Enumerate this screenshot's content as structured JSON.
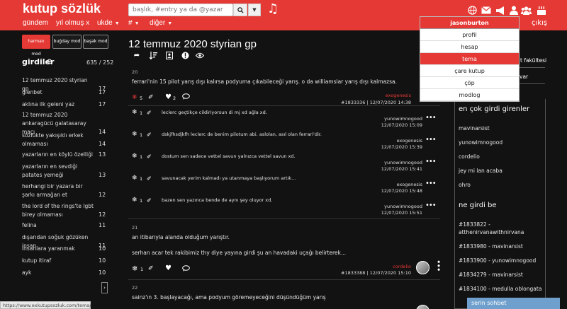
{
  "header": {
    "logo": "kutup sözlük",
    "search_placeholder": "başlık, #entry ya da @yazar",
    "nav": [
      "gündem",
      "yıl olmuş x",
      "ukde",
      "#",
      "diğer"
    ],
    "logout": "çıkış"
  },
  "user_menu": {
    "username": "jasonburton",
    "items": [
      "profil",
      "hesap",
      "tema",
      "çare kutup",
      "çöp",
      "modlog"
    ]
  },
  "sidebar": {
    "mods": [
      "harman mod",
      "buğday mod",
      "başak mod"
    ],
    "heading": "girdiler",
    "count": "635 / 252",
    "topics": [
      {
        "title": "12 temmuz 2020 styrian gp",
        "count": "17"
      },
      {
        "title": "glenbet",
        "count": "17"
      },
      {
        "title": "aklına ilk geleni yaz",
        "count": "17"
      },
      {
        "title": "12 temmuz 2020 ankaragücü galatasaray maçı",
        "count": "14"
      },
      {
        "title": "sözlükte yakışıklı erkek olmaması",
        "count": "14"
      },
      {
        "title": "yazarların en köylü özelliği",
        "count": "13"
      },
      {
        "title": "yazarların en sevdiği patates yemeği",
        "count": "13"
      },
      {
        "title": "herhangi bir yazara bir şarkı armağan et",
        "count": "12"
      },
      {
        "title": "the lord of the rings'te lgbt birey olmaması",
        "count": "12"
      },
      {
        "title": "felina",
        "count": "11"
      },
      {
        "title": "dışarıdan soğuk gözüken insan",
        "count": "11"
      },
      {
        "title": "insanlara yaranmak",
        "count": "10"
      },
      {
        "title": "kutup itiraf",
        "count": "10"
      },
      {
        "title": "ayk",
        "count": "10"
      }
    ],
    "pager": "›"
  },
  "status_url": "https://www.exkutupsozluk.com/tema/",
  "main": {
    "title": "12 temmuz 2020 styrian gp",
    "entries": [
      {
        "no": "20",
        "text": "ferrari'nin 15 pilot yarış dışı kalırsa podyuma çıkabileceği yarış. o da williamslar yarış dışı kalmazsa.",
        "likes": "5",
        "hearts": "2",
        "author": "exogenesis",
        "meta": "#1833336 | 12/07/2020 14:38"
      },
      {
        "no": "21",
        "text1": "an itibarıyla alanda olduğum yarıştır.",
        "text2": "serhan acar tek rakibimiz thy diye yayına girdi şu an havadaki uçağı belirterek...",
        "likes": "1",
        "author": "cordelio",
        "meta": "#1833388 | 12/07/2020 15:10"
      },
      {
        "no": "22",
        "text": "sainz'ın 3. başlayacağı, ama podyum göremeyeceğini düşündüğüm yarış"
      }
    ],
    "replies": [
      {
        "likes": "1",
        "text": "leclerc geçtikçe cildiriyorsun di mj xd ağla xd.",
        "author": "yunowimnogood",
        "date": "12/07/2020 15:09"
      },
      {
        "likes": "1",
        "text": "dskjfhsdjkfh leclerc de benim pilotum abi. aslolan, asıl olan ferrari'dir.",
        "author": "exogenesis",
        "date": "12/07/2020 15:39"
      },
      {
        "likes": "1",
        "text": "dostum sen sadece vettel savun yalnızca vettel savun xd.",
        "author": "yunowimnogood",
        "date": "12/07/2020 15:41"
      },
      {
        "likes": "1",
        "text": "savunacak yerim kalmadı ya utanmaya başlıyorum artık...",
        "author": "exogenesis",
        "date": "12/07/2020 15:48"
      },
      {
        "likes": "1",
        "text": "bazen sen yazınca bende de aynı şey oluyor xd.",
        "author": "yunowimnogood",
        "date": "12/07/2020 15:51"
      }
    ]
  },
  "right": {
    "partial_1": "t fakültesi",
    "partial_2": "var",
    "heading1": "en çok girdi girenler",
    "top_users": [
      "mavinarsist",
      "yunowimnogood",
      "cordelio",
      "jey mi lan acaba",
      "ohro"
    ],
    "heading2": "ne girdi be",
    "recent": [
      "#1833822 - atthenirvanawithnirvana",
      "#1833980 - mavinarsist",
      "#1833900 - yunowimnogood",
      "#1834279 - mavinarsist",
      "#1834100 - medulla oblongata"
    ]
  },
  "chat": "serin sohbet",
  "colors": {
    "accent": "#e53935",
    "background": "#121212",
    "chat": "#6f9fcc"
  }
}
